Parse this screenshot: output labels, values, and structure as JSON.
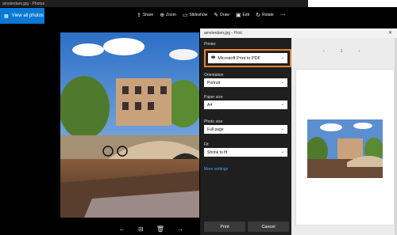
{
  "window": {
    "title": "amsterdam.jpg - Photos"
  },
  "view_all": {
    "label": "View all photos"
  },
  "toolbar": {
    "items": [
      {
        "icon": "share-icon",
        "glyph": "⇪",
        "label": "Share"
      },
      {
        "icon": "zoom-icon",
        "glyph": "⊕",
        "label": "Zoom"
      },
      {
        "icon": "slideshow-icon",
        "glyph": "▭",
        "label": "Slideshow"
      },
      {
        "icon": "draw-icon",
        "glyph": "✎",
        "label": "Draw"
      },
      {
        "icon": "edit-icon",
        "glyph": "▣",
        "label": "Edit"
      },
      {
        "icon": "rotate-icon",
        "glyph": "↻",
        "label": "Rotate"
      },
      {
        "icon": "more-icon",
        "glyph": "⋯",
        "label": ""
      }
    ]
  },
  "bottom_nav": {
    "prev": "←",
    "fit": "⊟",
    "delete": "🗑",
    "next": "→"
  },
  "print_dialog": {
    "title": "amsterdam.jpg - Print",
    "close": "✕",
    "printer_label": "Printer",
    "printer_value": "Microsoft Print to PDF",
    "orientation_label": "Orientation",
    "orientation_value": "Portrait",
    "paper_size_label": "Paper size",
    "paper_size_value": "A4",
    "photo_size_label": "Photo size",
    "photo_size_value": "Full page",
    "fit_label": "Fit",
    "fit_value": "Shrink to fit",
    "more_settings": "More settings",
    "print_button": "Print",
    "cancel_button": "Cancel",
    "page_number": "1",
    "prev_page": "‹",
    "next_page": "›"
  },
  "colors": {
    "accent": "#0a78d4",
    "printer_highlight": "#e6822e",
    "dialog_dark": "#1f1f1f",
    "link": "#4aa3ff"
  }
}
